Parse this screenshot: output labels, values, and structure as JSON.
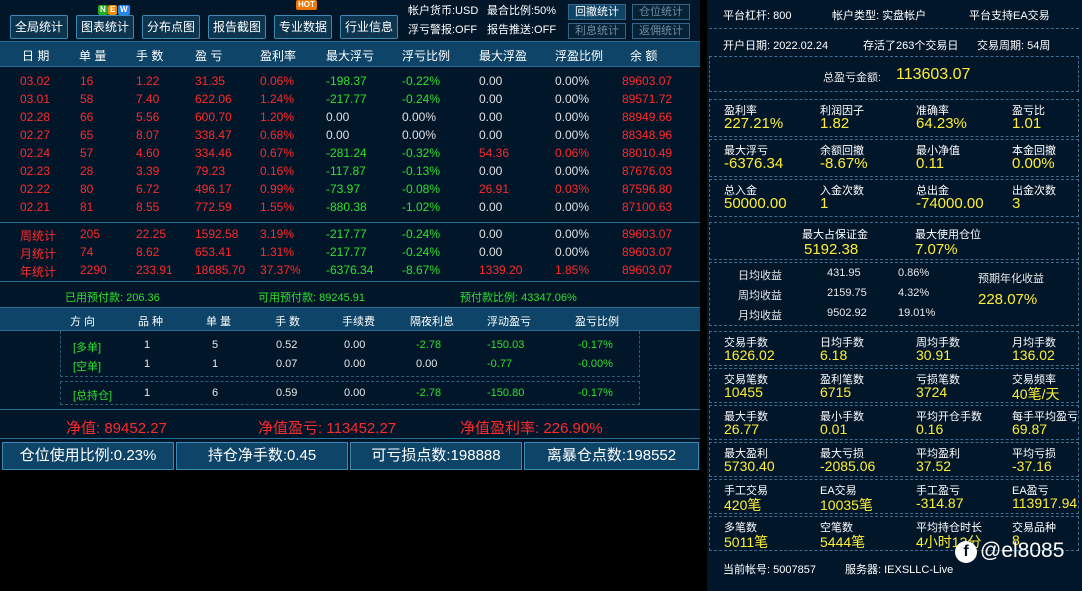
{
  "toolbar": {
    "buttons": [
      "全局统计",
      "图表统计",
      "分布点图",
      "报告截图",
      "专业数据",
      "行业信息"
    ],
    "badges": [
      "N",
      "E",
      "W",
      "HOT"
    ],
    "info": {
      "currency": "帐户货币:USD",
      "ratio": "最合比例:50%",
      "float_alarm": "浮亏警报:OFF",
      "report_push": "报告推送:OFF"
    },
    "small_buttons": [
      "回撤统计",
      "仓位统计",
      "利息统计",
      "返佣统计"
    ]
  },
  "daily_table": {
    "headers": [
      "日 期",
      "单 量",
      "手 数",
      "盈 亏",
      "盈利率",
      "最大浮亏",
      "浮亏比例",
      "最大浮盈",
      "浮盈比例",
      "余 额"
    ],
    "rows": [
      [
        "03.02",
        "16",
        "1.22",
        "31.35",
        "0.06%",
        "-198.37",
        "-0.22%",
        "0.00",
        "0.00%",
        "89603.07"
      ],
      [
        "03.01",
        "58",
        "7.40",
        "622.06",
        "1.24%",
        "-217.77",
        "-0.24%",
        "0.00",
        "0.00%",
        "89571.72"
      ],
      [
        "02.28",
        "66",
        "5.56",
        "600.70",
        "1.20%",
        "0.00",
        "0.00%",
        "0.00",
        "0.00%",
        "88949.66"
      ],
      [
        "02.27",
        "65",
        "8.07",
        "338.47",
        "0.68%",
        "0.00",
        "0.00%",
        "0.00",
        "0.00%",
        "88348.96"
      ],
      [
        "02.24",
        "57",
        "4.60",
        "334.46",
        "0.67%",
        "-281.24",
        "-0.32%",
        "54.36",
        "0.06%",
        "88010.49"
      ],
      [
        "02.23",
        "28",
        "3.39",
        "79.23",
        "0.16%",
        "-117.87",
        "-0.13%",
        "0.00",
        "0.00%",
        "87676.03"
      ],
      [
        "02.22",
        "80",
        "6.72",
        "496.17",
        "0.99%",
        "-73.97",
        "-0.08%",
        "26.91",
        "0.03%",
        "87596.80"
      ],
      [
        "02.21",
        "81",
        "8.55",
        "772.59",
        "1.55%",
        "-880.38",
        "-1.02%",
        "0.00",
        "0.00%",
        "87100.63"
      ]
    ],
    "summary": [
      [
        "周统计",
        "205",
        "22.25",
        "1592.58",
        "3.19%",
        "-217.77",
        "-0.24%",
        "0.00",
        "0.00%",
        "89603.07"
      ],
      [
        "月统计",
        "74",
        "8.62",
        "653.41",
        "1.31%",
        "-217.77",
        "-0.24%",
        "0.00",
        "0.00%",
        "89603.07"
      ],
      [
        "年统计",
        "2290",
        "233.91",
        "18685.70",
        "37.37%",
        "-6376.34",
        "-8.67%",
        "1339.20",
        "1.85%",
        "89603.07"
      ]
    ]
  },
  "prepayment": {
    "used": "已用预付款: 206.36",
    "available": "可用预付款: 89245.91",
    "ratio": "预付款比例: 43347.06%"
  },
  "position_table": {
    "headers": [
      "方 向",
      "品 种",
      "单 量",
      "手 数",
      "手续费",
      "隔夜利息",
      "浮动盈亏",
      "盈亏比例"
    ],
    "rows": [
      [
        "[多单]",
        "1",
        "5",
        "0.52",
        "0.00",
        "-2.78",
        "-150.03",
        "-0.17%"
      ],
      [
        "[空单]",
        "1",
        "1",
        "0.07",
        "0.00",
        "0.00",
        "-0.77",
        "-0.00%"
      ],
      [
        "[总持仓]",
        "1",
        "6",
        "0.59",
        "0.00",
        "-2.78",
        "-150.80",
        "-0.17%"
      ]
    ]
  },
  "net": {
    "value": "净值: 89452.27",
    "profit": "净值盈亏: 113452.27",
    "rate": "净值盈利率: 226.90%"
  },
  "bottom_bar": [
    "仓位使用比例:0.23%",
    "持仓净手数:0.45",
    "可亏损点数:198888",
    "离暴仓点数:198552"
  ],
  "account": {
    "leverage": "平台杠杆: 800",
    "type": "帐户类型: 实盘帐户",
    "ea": "平台支持EA交易",
    "open_date": "开户日期: 2022.02.24",
    "survived": "存活了263个交易日",
    "period": "交易周期: 54周",
    "total_label": "总盈亏金额:",
    "total_value": "113603.07"
  },
  "stats_blocks": [
    {
      "labels": [
        "盈利率",
        "利润因子",
        "准确率",
        "盈亏比"
      ],
      "values": [
        "227.21%",
        "1.82",
        "64.23%",
        "1.01"
      ]
    },
    {
      "labels": [
        "最大浮亏",
        "余额回撤",
        "最小净值",
        "本金回撤"
      ],
      "values": [
        "-6376.34",
        "-8.67%",
        "0.11",
        "0.00%"
      ]
    },
    {
      "labels": [
        "总入金",
        "入金次数",
        "总出金",
        "出金次数"
      ],
      "values": [
        "50000.00",
        "1",
        "-74000.00",
        "3"
      ]
    }
  ],
  "margin": {
    "labels": [
      "最大占保证金",
      "最大使用仓位"
    ],
    "values": [
      "5192.38",
      "7.07%"
    ]
  },
  "earnings": {
    "rows": [
      [
        "日均收益",
        "431.95",
        "0.86%"
      ],
      [
        "周均收益",
        "2159.75",
        "4.32%"
      ],
      [
        "月均收益",
        "9502.92",
        "19.01%"
      ]
    ],
    "annual_label": "预期年化收益",
    "annual_value": "228.07%"
  },
  "stats_blocks2": [
    {
      "labels": [
        "交易手数",
        "日均手数",
        "周均手数",
        "月均手数"
      ],
      "values": [
        "1626.02",
        "6.18",
        "30.91",
        "136.02"
      ]
    },
    {
      "labels": [
        "交易笔数",
        "盈利笔数",
        "亏损笔数",
        "交易频率"
      ],
      "values": [
        "10455",
        "6715",
        "3724",
        "40笔/天"
      ]
    },
    {
      "labels": [
        "最大手数",
        "最小手数",
        "平均开仓手数",
        "每手平均盈亏"
      ],
      "values": [
        "26.77",
        "0.01",
        "0.16",
        "69.87"
      ]
    },
    {
      "labels": [
        "最大盈利",
        "最大亏损",
        "平均盈利",
        "平均亏损"
      ],
      "values": [
        "5730.40",
        "-2085.06",
        "37.52",
        "-37.16"
      ]
    },
    {
      "labels": [
        "手工交易",
        "EA交易",
        "手工盈亏",
        "EA盈亏"
      ],
      "values": [
        "420笔",
        "10035笔",
        "-314.87",
        "113917.94"
      ]
    },
    {
      "labels": [
        "多笔数",
        "空笔数",
        "平均持仓时长",
        "交易品种"
      ],
      "values": [
        "5011笔",
        "5444笔",
        "4小时13分",
        "8"
      ]
    }
  ],
  "footer": {
    "account_no": "当前帐号: 5007857",
    "server": "服务器: IEXSLLC-Live"
  },
  "watermark": "@el8085",
  "colors": {
    "bg": "#02162a",
    "header": "#0e4467",
    "loss": "#ff2a2a",
    "gain": "#2fe02f",
    "value": "#ffee33"
  }
}
